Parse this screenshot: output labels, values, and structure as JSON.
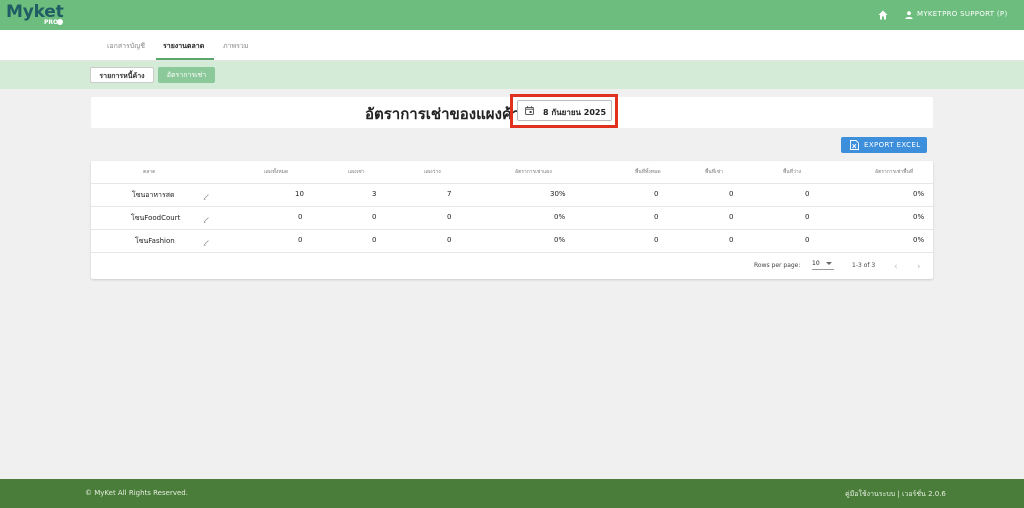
{
  "brand": {
    "name": "Myket",
    "suffix": "PRO"
  },
  "header": {
    "home_icon": "home-icon",
    "user_icon": "person-icon",
    "user_label": "MYKETPRO SUPPORT (P)"
  },
  "tabs": [
    {
      "label": "เอกสารบัญชี"
    },
    {
      "label": "รายงานตลาด",
      "active": true
    },
    {
      "label": "ภาพรวม"
    }
  ],
  "subtabs": [
    {
      "label": "รายการหนี้ค้าง"
    },
    {
      "label": "อัตราการเช่า",
      "active": true
    }
  ],
  "page": {
    "title": "อัตราการเช่าของแผงค้า",
    "date": "8 กันยายน 2025",
    "export_label": "EXPORT EXCEL"
  },
  "table": {
    "headers": [
      "ตลาด",
      "แผงทั้งหมด",
      "แผงเช่า",
      "แผงว่าง",
      "อัตราการเช่าแผง",
      "พื้นที่ทั้งหมด",
      "พื้นที่เช่า",
      "พื้นที่ว่าง",
      "อัตราการเช่าพื้นที่"
    ],
    "rows": [
      {
        "market": "โซนอาหารสด",
        "total": "10",
        "rented": "3",
        "vacant": "7",
        "rate": "30%",
        "area_total": "0",
        "area_rented": "0",
        "area_vacant": "0",
        "area_rate": "0%"
      },
      {
        "market": "โซนFoodCourt",
        "total": "0",
        "rented": "0",
        "vacant": "0",
        "rate": "0%",
        "area_total": "0",
        "area_rented": "0",
        "area_vacant": "0",
        "area_rate": "0%"
      },
      {
        "market": "โซนFashion",
        "total": "0",
        "rented": "0",
        "vacant": "0",
        "rate": "0%",
        "area_total": "0",
        "area_rented": "0",
        "area_vacant": "0",
        "area_rate": "0%"
      }
    ],
    "footer": {
      "rows_per_page_label": "Rows per page:",
      "rows_per_page": "10",
      "range": "1-3 of 3",
      "prev": "‹",
      "next": "›"
    }
  },
  "footer": {
    "copyright": "© MyKet All Rights Reserved.",
    "version": "คู่มือใช้งานระบบ | เวอร์ชั่น 2.0.6"
  },
  "colors": {
    "topbar": "#6dbd7f",
    "subbar": "#d4ebd8",
    "export_button": "#3d8fdc",
    "highlight": "#e0301e",
    "bottombar": "#4a7d3a"
  }
}
